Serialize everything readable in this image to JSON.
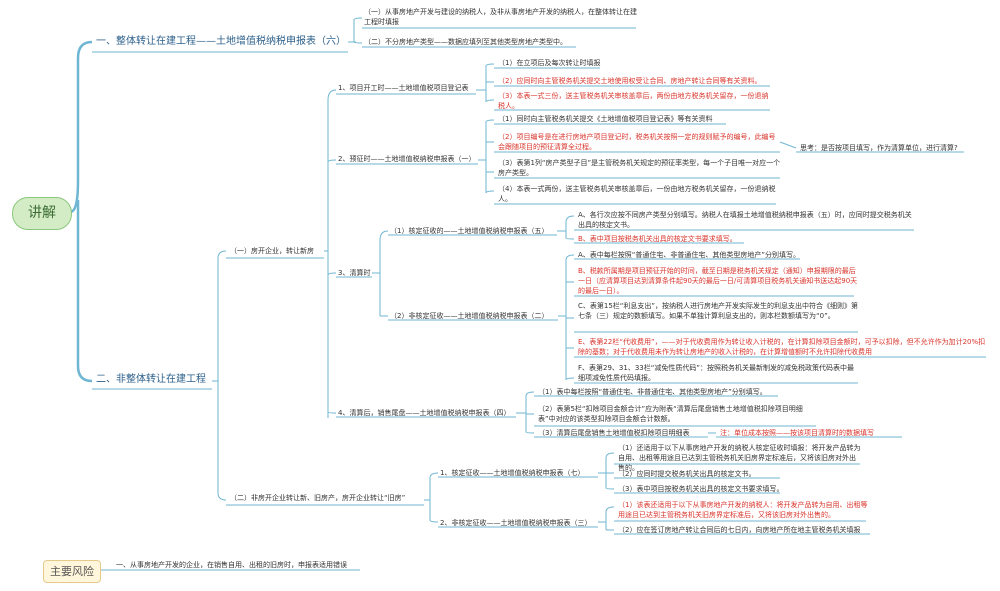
{
  "root": {
    "label": "讲解"
  },
  "branch1": {
    "title": "一、整体转让在建工程——土地增值税纳税申报表（六）",
    "items": [
      "（一）从事房地产开发与建设的纳税人，及非从事房地产开发的纳税人，在整体转让在建工程时填报",
      "（二）不分房地产类型——数据应填列至其他类型房地产类型中。"
    ]
  },
  "branch2": {
    "title": "二、非整体转让在建工程",
    "sub1": {
      "label": "（一）房开企业，转让新房",
      "s1": {
        "label": "1、项目开工时——土地增值税项目登记表",
        "items": [
          "（1）在立项后及每次转让时填报",
          "（2）应同时向主管税务机关提交土地使用权受让合同、房地产转让合同等有关资料。",
          "（3）本表一式三份，送主管税务机关审核盖章后，两份由地方税务机关留存，一份退纳税人。"
        ]
      },
      "s2": {
        "label": "2、预征时——土地增值税纳税申报表（一）",
        "items": [
          "（1）同时向主管税务机关提交《土地增值税项目登记表》等有关资料",
          "（2）项目编号是在进行房地产项目登记时，税务机关按照一定的规则赋予的编号，此编号会跟随项目的预征清算全过程。",
          "（3）表第1列“房产类型子目”是主管税务机关规定的预征率类型，每一个子目唯一对应一个房产类型。",
          "（4）本表一式两份，送主管税务机关审核盖章后，一份由地方税务机关留存，一份退纳税人。"
        ],
        "note": "思考：是否按项目填写，作为清算单位，进行清算?"
      },
      "s3": {
        "label": "3、清算时",
        "a": {
          "label": "（1）核定征收的——土地增值税纳税申报表（五）",
          "items": [
            "A、各行次应按不同房产类型分别填写。纳税人在填报土地增值税纳税申报表（五）时，应同时提交税务机关出具的核定文书。",
            "B、表中项目按税务机关出具的核定文书要求填写。"
          ]
        },
        "b": {
          "label": "（2）非核定征收——土地增值税纳税申报表（二）",
          "items": [
            "A、表中每栏按照“普通住宅、非普通住宅、其他类型房地产”分别填写。",
            "B、税款所属期是项目预征开始的时间，截至日期是税务机关规定（通知）申报期限的最后一日（应清算项目达到清算条件起90天的最后一日/可清算项目税务机关通知书送达起90天的最后一日）。",
            "C、表第15栏“利息支出”，按纳税人进行房地产开发实际发生的利息支出中符合《细则》第七条（三）规定的数额填写。如果不单独计算利息支出的，则本栏数额填写为“0”。",
            "E、表第22栏“代收费用”，——对于代收费用作为转让收入计税的，在计算扣除项目金额时，可予以扣除，但不允许作为加计20%扣除的基数；对于代收费用未作为转让房地产的收入计税的，在计算增值额时不允许扣除代收费用",
            "F、表第29、31、33栏“减免性质代码”：按照税务机关最新制发的减免税政策代码表中最细项减免性质代码填报。"
          ]
        }
      },
      "s4": {
        "label": "4、清算后，销售尾盘——土地增值税纳税申报表（四）",
        "items": [
          "（1）表中每栏按照“普通住宅、非普通住宅、其他类型房地产”分别填写。",
          "（2）表第5栏“扣除项目金额合计”应为附表“清算后尾盘销售土地增值税扣除项目明细表”中对应的该类型扣除项目金额合计数额。",
          "（3）清算后尾盘销售土地增值税扣除项目明细表"
        ],
        "note": "注：单位成本按照——按该项目清算时的数据填写"
      }
    },
    "sub2": {
      "label": "（二）非房开企业转让新、旧房产，房开企业转让“旧房”",
      "c1": {
        "label": "1、核定征收——土地增值税纳税申报表（七）",
        "items": [
          "（1）还适用于以下从事房地产开发的纳税人核定征收时填报：将开发产品转为自用、出租等用途且已达到主管税务机关旧房界定标准后，又将该旧房对外出售的。",
          "（2）应同时提交税务机关出具的核定文书。",
          "（3）表中项目按税务机关出具的核定文书要求填写。"
        ]
      },
      "c2": {
        "label": "2、非核定征收——土地增值税纳税申报表（三）",
        "items": [
          "（1）该表还适用于以下从事房地产开发的纳税人：将开发产品转为自用、出租等用途且已达到主管税务机关旧房界定标准后，又将该旧房对外出售的。",
          "（2）应在签订房地产转让合同后的七日内，向房地产所在地主管税务机关填报"
        ]
      }
    }
  },
  "risk": {
    "label": "主要风险",
    "items": [
      "一、从事房地产开发的企业，在销售自用、出租的旧房时，申报表适用错误"
    ]
  },
  "colors": {
    "line": "#6fb6d3",
    "red_text": "#d9342b",
    "root_fill": "#d3ecc5",
    "risk_fill": "#fff6db"
  }
}
